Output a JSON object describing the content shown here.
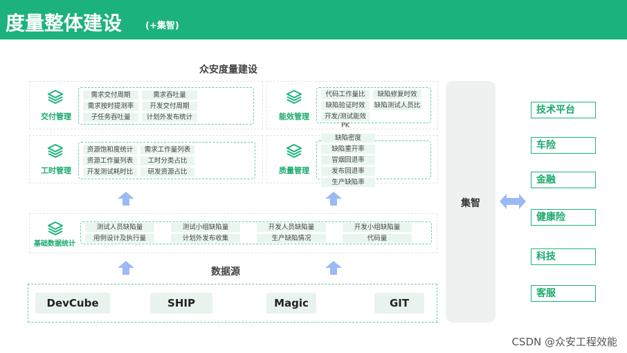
{
  "header": {
    "title": "度量整体建设",
    "subtitle": "(+集智)"
  },
  "main_title": "众安度量建设",
  "modules": [
    {
      "label": "交付管理",
      "items": [
        "需求交付周期",
        "需求吞吐量",
        "需求按时提测率",
        "开发交付周期",
        "子任务吞吐量",
        "计划外发布统计"
      ]
    },
    {
      "label": "能效管理",
      "items": [
        "代码工作量比",
        "缺陷修复时效",
        "缺陷验证时效",
        "缺陷测试人员比",
        "开发/测试能效PK"
      ]
    },
    {
      "label": "工时管理",
      "items": [
        "资源饱和度统计",
        "需求工作量列表",
        "资源工作量列表",
        "工时分类占比",
        "开发测试耗时比",
        "研发资源占比"
      ]
    },
    {
      "label": "质量管理",
      "items": [
        "缺陷密度",
        "缺陷重开率",
        "冒烟回退率",
        "发布回退率",
        "生产缺陷率"
      ]
    },
    {
      "label": "基础数据统计",
      "items": [
        "测试人员缺陷量",
        "测试小组缺陷量",
        "开发人员缺陷量",
        "开发小组缺陷量",
        "用例设计及执行量",
        "计划外发布收集",
        "生产缺陷情况",
        "代码量"
      ]
    }
  ],
  "data_source": {
    "title": "数据源",
    "items": [
      "DevCube",
      "SHIP",
      "Magic",
      "GIT"
    ]
  },
  "jizhi": "集智",
  "targets": [
    "技术平台",
    "车险",
    "金融",
    "健康险",
    "科技",
    "客服"
  ],
  "watermark": "CSDN @众安工程效能",
  "colors": {
    "accent": "#1cb27b",
    "arrow": "#9bb9f5"
  }
}
